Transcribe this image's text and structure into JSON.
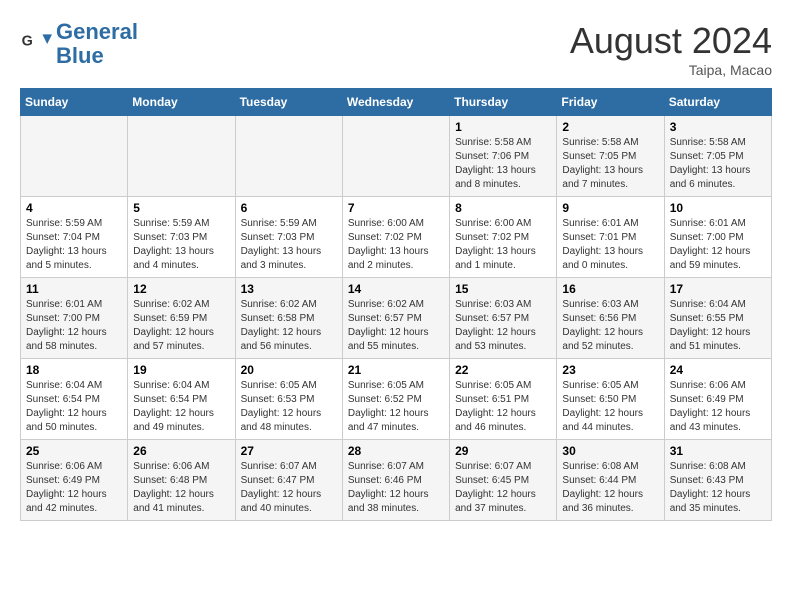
{
  "header": {
    "logo_line1": "General",
    "logo_line2": "Blue",
    "month": "August 2024",
    "location": "Taipa, Macao"
  },
  "weekdays": [
    "Sunday",
    "Monday",
    "Tuesday",
    "Wednesday",
    "Thursday",
    "Friday",
    "Saturday"
  ],
  "weeks": [
    [
      {
        "day": "",
        "info": ""
      },
      {
        "day": "",
        "info": ""
      },
      {
        "day": "",
        "info": ""
      },
      {
        "day": "",
        "info": ""
      },
      {
        "day": "1",
        "info": "Sunrise: 5:58 AM\nSunset: 7:06 PM\nDaylight: 13 hours\nand 8 minutes."
      },
      {
        "day": "2",
        "info": "Sunrise: 5:58 AM\nSunset: 7:05 PM\nDaylight: 13 hours\nand 7 minutes."
      },
      {
        "day": "3",
        "info": "Sunrise: 5:58 AM\nSunset: 7:05 PM\nDaylight: 13 hours\nand 6 minutes."
      }
    ],
    [
      {
        "day": "4",
        "info": "Sunrise: 5:59 AM\nSunset: 7:04 PM\nDaylight: 13 hours\nand 5 minutes."
      },
      {
        "day": "5",
        "info": "Sunrise: 5:59 AM\nSunset: 7:03 PM\nDaylight: 13 hours\nand 4 minutes."
      },
      {
        "day": "6",
        "info": "Sunrise: 5:59 AM\nSunset: 7:03 PM\nDaylight: 13 hours\nand 3 minutes."
      },
      {
        "day": "7",
        "info": "Sunrise: 6:00 AM\nSunset: 7:02 PM\nDaylight: 13 hours\nand 2 minutes."
      },
      {
        "day": "8",
        "info": "Sunrise: 6:00 AM\nSunset: 7:02 PM\nDaylight: 13 hours\nand 1 minute."
      },
      {
        "day": "9",
        "info": "Sunrise: 6:01 AM\nSunset: 7:01 PM\nDaylight: 13 hours\nand 0 minutes."
      },
      {
        "day": "10",
        "info": "Sunrise: 6:01 AM\nSunset: 7:00 PM\nDaylight: 12 hours\nand 59 minutes."
      }
    ],
    [
      {
        "day": "11",
        "info": "Sunrise: 6:01 AM\nSunset: 7:00 PM\nDaylight: 12 hours\nand 58 minutes."
      },
      {
        "day": "12",
        "info": "Sunrise: 6:02 AM\nSunset: 6:59 PM\nDaylight: 12 hours\nand 57 minutes."
      },
      {
        "day": "13",
        "info": "Sunrise: 6:02 AM\nSunset: 6:58 PM\nDaylight: 12 hours\nand 56 minutes."
      },
      {
        "day": "14",
        "info": "Sunrise: 6:02 AM\nSunset: 6:57 PM\nDaylight: 12 hours\nand 55 minutes."
      },
      {
        "day": "15",
        "info": "Sunrise: 6:03 AM\nSunset: 6:57 PM\nDaylight: 12 hours\nand 53 minutes."
      },
      {
        "day": "16",
        "info": "Sunrise: 6:03 AM\nSunset: 6:56 PM\nDaylight: 12 hours\nand 52 minutes."
      },
      {
        "day": "17",
        "info": "Sunrise: 6:04 AM\nSunset: 6:55 PM\nDaylight: 12 hours\nand 51 minutes."
      }
    ],
    [
      {
        "day": "18",
        "info": "Sunrise: 6:04 AM\nSunset: 6:54 PM\nDaylight: 12 hours\nand 50 minutes."
      },
      {
        "day": "19",
        "info": "Sunrise: 6:04 AM\nSunset: 6:54 PM\nDaylight: 12 hours\nand 49 minutes."
      },
      {
        "day": "20",
        "info": "Sunrise: 6:05 AM\nSunset: 6:53 PM\nDaylight: 12 hours\nand 48 minutes."
      },
      {
        "day": "21",
        "info": "Sunrise: 6:05 AM\nSunset: 6:52 PM\nDaylight: 12 hours\nand 47 minutes."
      },
      {
        "day": "22",
        "info": "Sunrise: 6:05 AM\nSunset: 6:51 PM\nDaylight: 12 hours\nand 46 minutes."
      },
      {
        "day": "23",
        "info": "Sunrise: 6:05 AM\nSunset: 6:50 PM\nDaylight: 12 hours\nand 44 minutes."
      },
      {
        "day": "24",
        "info": "Sunrise: 6:06 AM\nSunset: 6:49 PM\nDaylight: 12 hours\nand 43 minutes."
      }
    ],
    [
      {
        "day": "25",
        "info": "Sunrise: 6:06 AM\nSunset: 6:49 PM\nDaylight: 12 hours\nand 42 minutes."
      },
      {
        "day": "26",
        "info": "Sunrise: 6:06 AM\nSunset: 6:48 PM\nDaylight: 12 hours\nand 41 minutes."
      },
      {
        "day": "27",
        "info": "Sunrise: 6:07 AM\nSunset: 6:47 PM\nDaylight: 12 hours\nand 40 minutes."
      },
      {
        "day": "28",
        "info": "Sunrise: 6:07 AM\nSunset: 6:46 PM\nDaylight: 12 hours\nand 38 minutes."
      },
      {
        "day": "29",
        "info": "Sunrise: 6:07 AM\nSunset: 6:45 PM\nDaylight: 12 hours\nand 37 minutes."
      },
      {
        "day": "30",
        "info": "Sunrise: 6:08 AM\nSunset: 6:44 PM\nDaylight: 12 hours\nand 36 minutes."
      },
      {
        "day": "31",
        "info": "Sunrise: 6:08 AM\nSunset: 6:43 PM\nDaylight: 12 hours\nand 35 minutes."
      }
    ]
  ]
}
